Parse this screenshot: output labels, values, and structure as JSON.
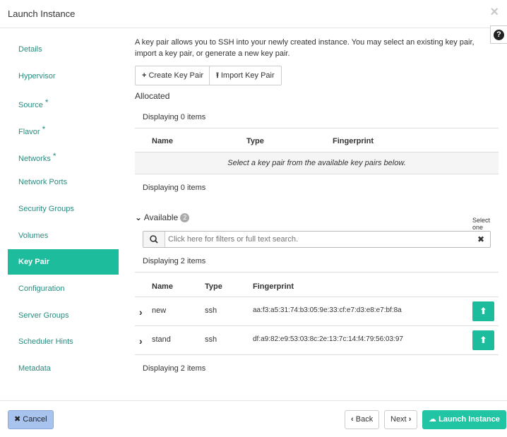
{
  "dialog": {
    "title": "Launch Instance",
    "close_icon": "×",
    "help_icon": "?"
  },
  "sidebar": {
    "items": [
      {
        "label": "Details",
        "required": false
      },
      {
        "label": "Hypervisor",
        "required": false
      },
      {
        "label": "Source",
        "required": true
      },
      {
        "label": "Flavor",
        "required": true
      },
      {
        "label": "Networks",
        "required": true
      },
      {
        "label": "Network Ports",
        "required": false
      },
      {
        "label": "Security Groups",
        "required": false
      },
      {
        "label": "Volumes",
        "required": false
      },
      {
        "label": "Key Pair",
        "required": false,
        "active": true
      },
      {
        "label": "Configuration",
        "required": false
      },
      {
        "label": "Server Groups",
        "required": false
      },
      {
        "label": "Scheduler Hints",
        "required": false
      },
      {
        "label": "Metadata",
        "required": false
      }
    ],
    "required_mark": "*"
  },
  "main": {
    "description": "A key pair allows you to SSH into your newly created instance. You may select an existing key pair, import a key pair, or generate a new key pair.",
    "create_button": {
      "icon": "+",
      "label": "Create Key Pair"
    },
    "import_button": {
      "icon": "⭱",
      "label": "Import Key Pair"
    },
    "allocated": {
      "title": "Allocated",
      "displaying_top": "Displaying 0 items",
      "columns": [
        "Name",
        "Type",
        "Fingerprint"
      ],
      "empty_message": "Select a key pair from the available key pairs below.",
      "displaying_bottom": "Displaying 0 items"
    },
    "available": {
      "toggle_icon": "⌄",
      "title": "Available",
      "count": "2",
      "select_hint": "Select one",
      "search_placeholder": "Click here for filters or full text search.",
      "search_icon": "search-icon",
      "clear_icon": "✖",
      "displaying_top": "Displaying 2 items",
      "columns": [
        "Name",
        "Type",
        "Fingerprint"
      ],
      "rows": [
        {
          "name": "new",
          "type": "ssh",
          "fingerprint": "aa:f3:a5:31:74:b3:05:9e:33:cf:e7:d3:e8:e7:bf:8a"
        },
        {
          "name": "stand",
          "type": "ssh",
          "fingerprint": "df:a9:82:e9:53:03:8c:2e:13:7c:14:f4:79:56:03:97"
        }
      ],
      "expand_icon": "›",
      "allocate_icon": "⬆",
      "displaying_bottom": "Displaying 2 items"
    }
  },
  "footer": {
    "cancel": {
      "icon": "✖",
      "label": "Cancel"
    },
    "back": {
      "icon": "‹",
      "label": "Back"
    },
    "next": {
      "icon": "›",
      "label": "Next"
    },
    "launch": {
      "icon": "☁",
      "label": "Launch Instance"
    }
  },
  "colors": {
    "accent": "#1cbc9c",
    "link": "#2a8c7e",
    "cancel_bg": "#a8c4ee"
  }
}
